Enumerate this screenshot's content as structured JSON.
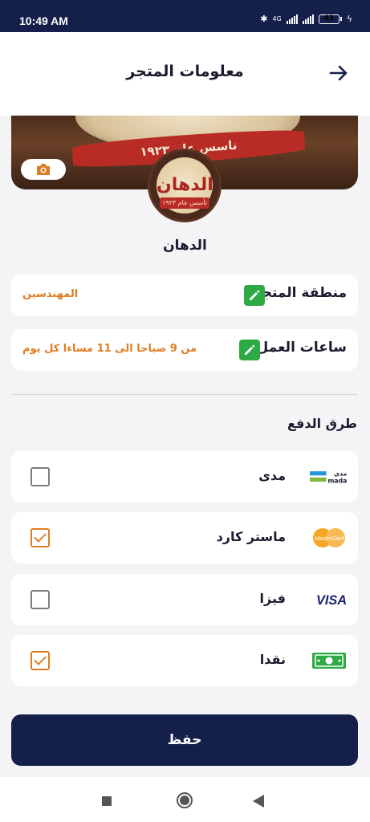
{
  "status_bar": {
    "time": "10:49 AM",
    "network": "4G",
    "battery": "43"
  },
  "header": {
    "title": "معلومات المتجر",
    "back_icon": "arrow-right-icon"
  },
  "cover": {
    "banner_text": "ناسس عام ١٩٢٣",
    "camera_icon": "camera-icon"
  },
  "logo": {
    "text": "الدهان",
    "ribbon": "تأسس عام ١٩٢٣"
  },
  "store": {
    "name": "الدهان"
  },
  "info": {
    "area_label": "منطقة المتجر",
    "area_value": "المهندسين",
    "hours_label": "ساعات العمل",
    "hours_value": "من 9 صباحا الى 11 مساءا كل يوم"
  },
  "payment": {
    "title": "طرق الدفع",
    "methods": [
      {
        "label": "مدى",
        "icon": "mada-icon",
        "checked": false,
        "icon_text_top": "مدى",
        "icon_text_bottom": "mada"
      },
      {
        "label": "ماستر كارد",
        "icon": "mastercard-icon",
        "checked": true,
        "icon_text": "MasterCard"
      },
      {
        "label": "فيزا",
        "icon": "visa-icon",
        "checked": false,
        "icon_text": "VISA"
      },
      {
        "label": "نقدا",
        "icon": "cash-icon",
        "checked": true
      }
    ]
  },
  "actions": {
    "save_label": "حفظ"
  },
  "colors": {
    "primary": "#15204a",
    "accent": "#e07d24",
    "edit_green": "#2eaa45"
  }
}
